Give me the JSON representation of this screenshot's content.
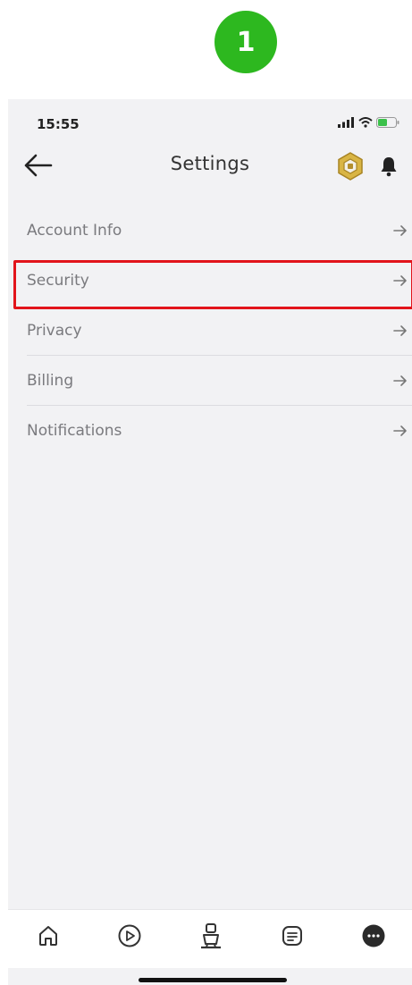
{
  "step_badge": "1",
  "status_bar": {
    "time": "15:55",
    "icons": [
      "cellular-signal-icon",
      "wifi-icon",
      "battery-icon"
    ]
  },
  "header": {
    "title": "Settings",
    "back_icon": "arrow-left-icon",
    "robux_icon": "robux-icon",
    "notification_icon": "bell-icon"
  },
  "menu": {
    "items": [
      {
        "label": "Account Info"
      },
      {
        "label": "Security",
        "highlighted": true
      },
      {
        "label": "Privacy"
      },
      {
        "label": "Billing"
      },
      {
        "label": "Notifications"
      }
    ],
    "item_icon": "arrow-right-icon"
  },
  "tabbar": {
    "tabs": [
      "home-icon",
      "play-icon",
      "avatar-icon",
      "chat-icon",
      "more-icon"
    ]
  },
  "colors": {
    "highlight": "#e2141b",
    "badge": "#2db81f",
    "robux_gold": "#c9a227",
    "background": "#f2f2f4"
  }
}
